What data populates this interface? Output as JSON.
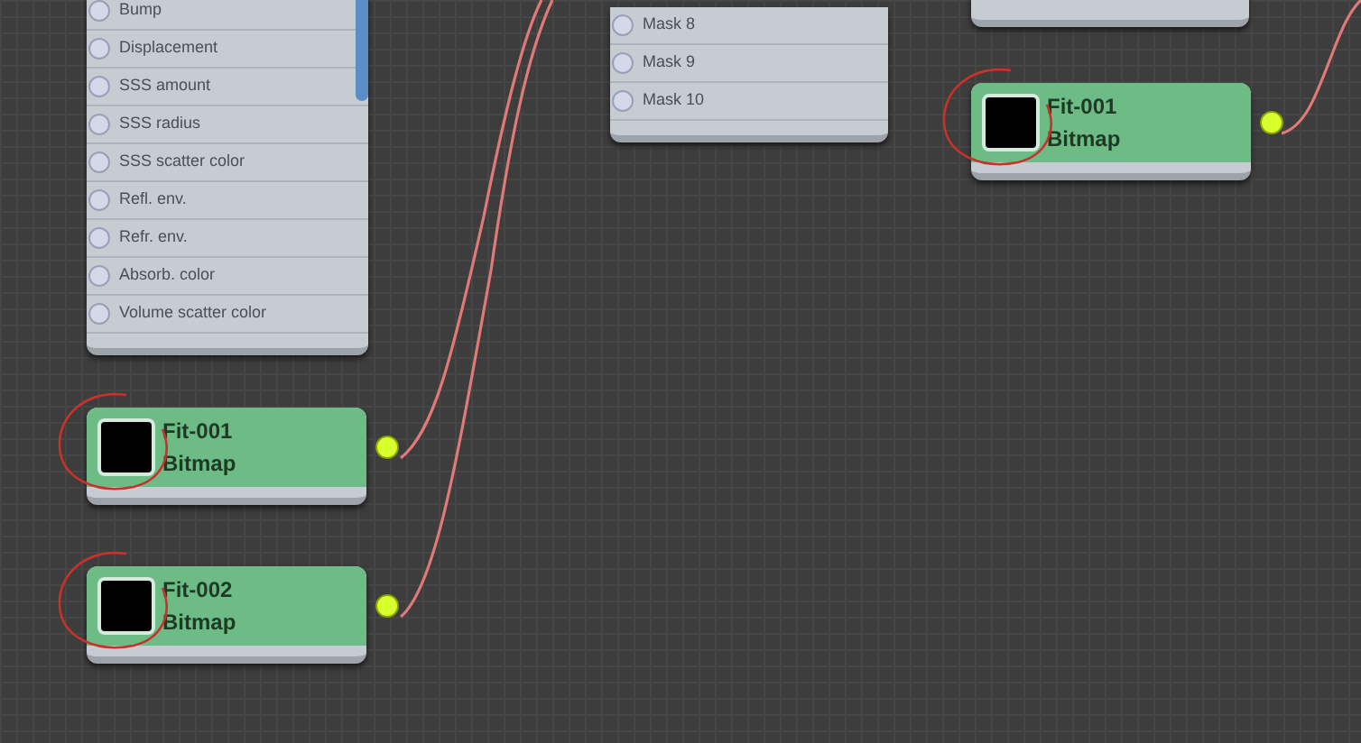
{
  "nodes": [
    {
      "kind": "list",
      "sockets": [
        "Bump",
        "Displacement",
        "SSS amount",
        "SSS radius",
        "SSS scatter color",
        "Refl. env.",
        "Refr. env.",
        "Absorb. color",
        "Volume scatter color"
      ]
    },
    {
      "kind": "list",
      "sockets": [
        "Mask 8",
        "Mask 9",
        "Mask 10"
      ]
    },
    {
      "kind": "stub"
    },
    {
      "kind": "bitmap",
      "name": "Fit-001",
      "type": "Bitmap",
      "circled": true
    },
    {
      "kind": "bitmap",
      "name": "Fit-001",
      "type": "Bitmap",
      "circled": true
    },
    {
      "kind": "bitmap",
      "name": "Fit-002",
      "type": "Bitmap",
      "circled": true
    }
  ]
}
